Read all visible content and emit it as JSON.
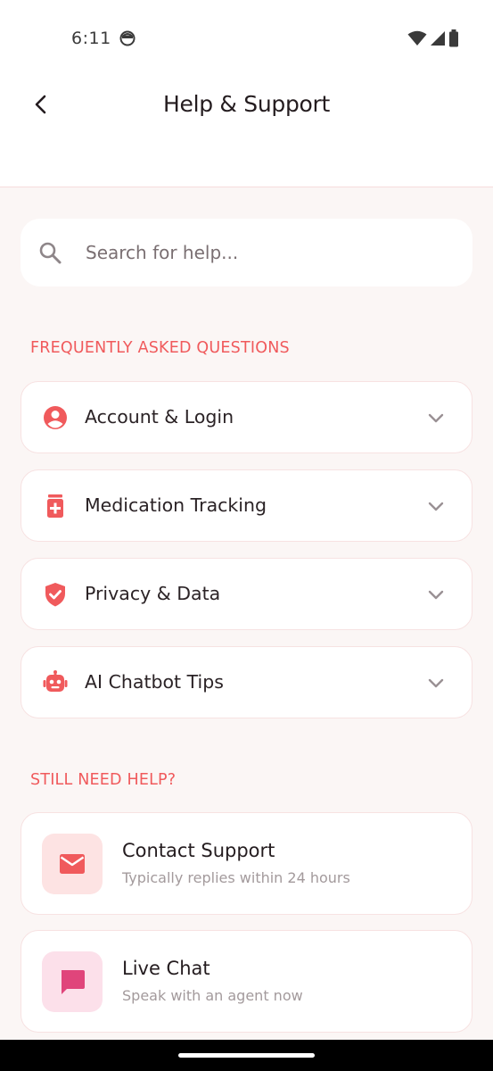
{
  "status_bar": {
    "time": "6:11",
    "icons": [
      "face-icon",
      "wifi-icon",
      "signal-icon",
      "battery-icon"
    ]
  },
  "header": {
    "title": "Help & Support",
    "back_icon": "chevron-left-icon"
  },
  "search": {
    "placeholder": "Search for help...",
    "value": "",
    "icon": "search-icon"
  },
  "faq": {
    "heading": "FREQUENTLY ASKED QUESTIONS",
    "items": [
      {
        "label": "Account & Login",
        "icon": "account-circle-icon"
      },
      {
        "label": "Medication Tracking",
        "icon": "medication-icon"
      },
      {
        "label": "Privacy & Data",
        "icon": "shield-check-icon"
      },
      {
        "label": "AI Chatbot Tips",
        "icon": "robot-icon"
      }
    ]
  },
  "help": {
    "heading": "STILL NEED HELP?",
    "cards": [
      {
        "title": "Contact Support",
        "subtitle": "Typically replies within 24 hours",
        "icon": "mail-icon"
      },
      {
        "title": "Live Chat",
        "subtitle": "Speak with an agent now",
        "icon": "chat-icon"
      }
    ]
  },
  "colors": {
    "accent": "#f05a5c",
    "chat_accent": "#e0457b",
    "background": "#fbf6f5",
    "card": "#ffffff"
  }
}
